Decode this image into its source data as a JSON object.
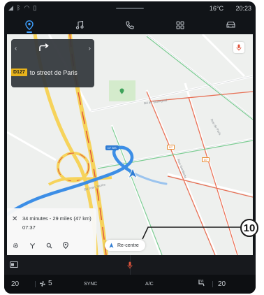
{
  "status_bar": {
    "temperature": "16°C",
    "time": "20:23"
  },
  "top_nav": {
    "items": [
      {
        "icon": "navigation-pin-icon",
        "active": true
      },
      {
        "icon": "music-icon",
        "active": false
      },
      {
        "icon": "phone-icon",
        "active": false
      },
      {
        "icon": "apps-grid-icon",
        "active": false
      },
      {
        "icon": "car-icon",
        "active": false
      }
    ]
  },
  "direction_panel": {
    "road_number": "D127",
    "destination": "to street de Paris"
  },
  "map": {
    "route_label": "D7 BIS",
    "road_numbers": [
      "D7",
      "D7"
    ],
    "colors": {
      "route": "#3c8ee6",
      "major_road": "#f6d35b",
      "traffic_red": "#e0533b",
      "park": "#cfe8c7"
    }
  },
  "trip_panel": {
    "summary": "34 minutes - 29 miles (47 km)",
    "arrival": "07:37",
    "recentre_label": "Re-centre"
  },
  "climate_bar": {
    "temp_left": "20",
    "fan_level": "5",
    "sync_label": "SYNC",
    "ac_label": "A/C",
    "temp_right": "20"
  },
  "callout": {
    "number": "10"
  }
}
